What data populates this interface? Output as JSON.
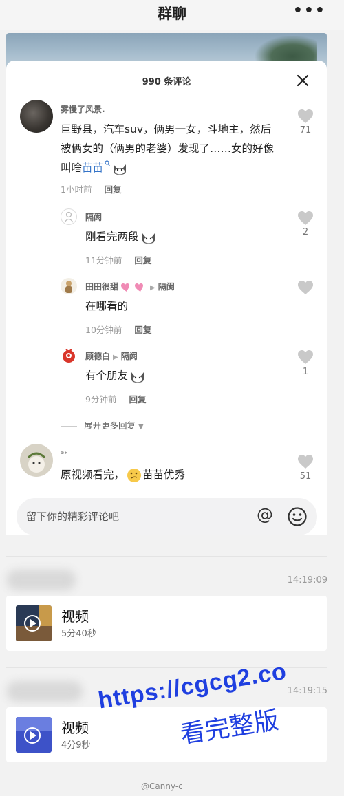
{
  "header": {
    "title": "群聊",
    "more": "•••"
  },
  "sheet": {
    "title": "990 条评论",
    "comments": [
      {
        "user": "雾慢了风景.",
        "text_before": "巨野县，汽车suv，俩男一女，斗地主，然后被俩女的（俩男的老婆）发现了……女的好像叫啥",
        "text_highlight": "苗苗",
        "time": "1小时前",
        "reply": "回复",
        "likes": "71",
        "replies": [
          {
            "user": "隔阂",
            "reply_to": "",
            "text": "刚看完两段",
            "time": "11分钟前",
            "reply": "回复",
            "likes": "2"
          },
          {
            "user": "田田很甜",
            "reply_to": "隔阂",
            "text": "在哪看的",
            "time": "10分钟前",
            "reply": "回复",
            "likes": ""
          },
          {
            "user": "顾德白",
            "reply_to": "隔阂",
            "text": "有个朋友",
            "time": "9分钟前",
            "reply": "回复",
            "likes": "1"
          }
        ],
        "expand": "展开更多回复"
      },
      {
        "user": "➳",
        "text_before": "原视频看完，",
        "text_after": "苗苗优秀",
        "likes": "51"
      }
    ],
    "input_placeholder": "留下你的精彩评论吧",
    "at_symbol": "@"
  },
  "messages": [
    {
      "time": "14:19:09",
      "title": "视频",
      "duration": "5分40秒"
    },
    {
      "time": "14:19:15",
      "title": "视频",
      "duration": "4分9秒"
    }
  ],
  "watermark": {
    "url": "https://cgcg2.co",
    "text": "看完整版",
    "weibo": "@Canny-c"
  },
  "colors": {
    "highlight": "#3574c8",
    "watermark": "#1f3fe0"
  }
}
